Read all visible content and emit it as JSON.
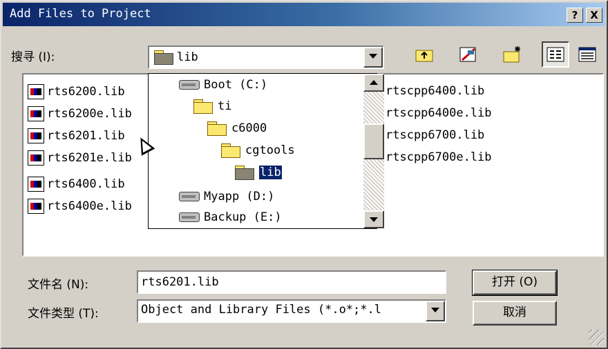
{
  "window": {
    "title": "Add Files to Project",
    "help_btn": "?",
    "close_btn": "X"
  },
  "look_in": {
    "label": "搜寻 (I):",
    "value": "lib"
  },
  "toolbar": [
    {
      "name": "up-folder-icon"
    },
    {
      "name": "desktop-icon"
    },
    {
      "name": "new-folder-icon"
    },
    {
      "name": "list-view-icon"
    },
    {
      "name": "details-view-icon"
    }
  ],
  "files": {
    "left": [
      "rts6200.lib",
      "rts6200e.lib",
      "rts6201.lib",
      "rts6201e.lib",
      "rts6400.lib",
      "rts6400e.lib"
    ],
    "right": [
      "rtscpp6400.lib",
      "rtscpp6400e.lib",
      "rtscpp6700.lib",
      "rtscpp6700e.lib"
    ]
  },
  "dropdown": {
    "items": [
      {
        "label": "Boot (C:)",
        "type": "drive"
      },
      {
        "label": "ti",
        "type": "folder"
      },
      {
        "label": "c6000",
        "type": "folder"
      },
      {
        "label": "cgtools",
        "type": "folder"
      },
      {
        "label": "lib",
        "type": "folder-open",
        "selected": true
      },
      {
        "label": "Myapp (D:)",
        "type": "drive"
      },
      {
        "label": "Backup (E:)",
        "type": "drive"
      }
    ]
  },
  "filename": {
    "label": "文件名 (N):",
    "value": "rts6201.lib"
  },
  "filetype": {
    "label": "文件类型 (T):",
    "value": "Object and Library Files (*.o*;*.l"
  },
  "buttons": {
    "open": "打开 (O)",
    "cancel": "取消"
  }
}
